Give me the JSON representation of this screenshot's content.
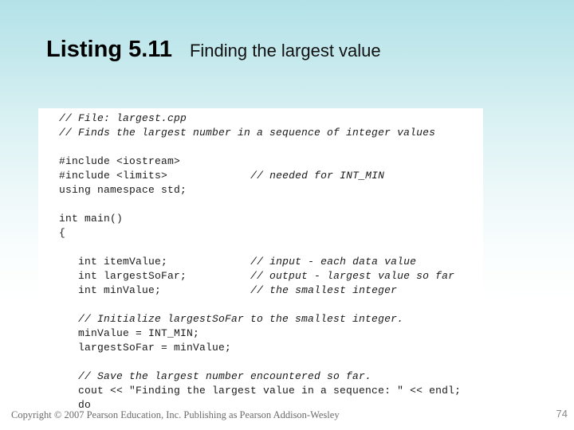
{
  "slide": {
    "background_top_color": "#b3e2e8",
    "background_bottom_color": "#ffffff"
  },
  "title": {
    "main": "Listing 5.11",
    "subtitle": "Finding the largest value"
  },
  "code": {
    "language": "cpp",
    "panel_background": "#ffffff",
    "lines": [
      {
        "code": "// File: largest.cpp",
        "comment": "",
        "comment_col": 0,
        "code_italic": true
      },
      {
        "code": "// Finds the largest number in a sequence of integer values",
        "comment": "",
        "comment_col": 0,
        "code_italic": true
      },
      {
        "code": "",
        "comment": "",
        "comment_col": 0,
        "code_italic": false
      },
      {
        "code": "#include <iostream>",
        "comment": "",
        "comment_col": 0,
        "code_italic": false
      },
      {
        "code": "#include <limits>",
        "comment": "// needed for INT_MIN",
        "comment_col": 30,
        "code_italic": false
      },
      {
        "code": "using namespace std;",
        "comment": "",
        "comment_col": 0,
        "code_italic": false
      },
      {
        "code": "",
        "comment": "",
        "comment_col": 0,
        "code_italic": false
      },
      {
        "code": "int main()",
        "comment": "",
        "comment_col": 0,
        "code_italic": false
      },
      {
        "code": "{",
        "comment": "",
        "comment_col": 0,
        "code_italic": false
      },
      {
        "code": "",
        "comment": "",
        "comment_col": 0,
        "code_italic": false
      },
      {
        "code": "   int itemValue;",
        "comment": "// input - each data value",
        "comment_col": 30,
        "code_italic": false
      },
      {
        "code": "   int largestSoFar;",
        "comment": "// output - largest value so far",
        "comment_col": 30,
        "code_italic": false
      },
      {
        "code": "   int minValue;",
        "comment": "// the smallest integer",
        "comment_col": 30,
        "code_italic": false
      },
      {
        "code": "",
        "comment": "",
        "comment_col": 0,
        "code_italic": false
      },
      {
        "code": "   // Initialize largestSoFar to the smallest integer.",
        "comment": "",
        "comment_col": 0,
        "code_italic": true
      },
      {
        "code": "   minValue = INT_MIN;",
        "comment": "",
        "comment_col": 0,
        "code_italic": false
      },
      {
        "code": "   largestSoFar = minValue;",
        "comment": "",
        "comment_col": 0,
        "code_italic": false
      },
      {
        "code": "",
        "comment": "",
        "comment_col": 0,
        "code_italic": false
      },
      {
        "code": "   // Save the largest number encountered so far.",
        "comment": "",
        "comment_col": 0,
        "code_italic": true
      },
      {
        "code": "   cout << \"Finding the largest value in a sequence: \" << endl;",
        "comment": "",
        "comment_col": 0,
        "code_italic": false
      },
      {
        "code": "   do",
        "comment": "",
        "comment_col": 0,
        "code_italic": false
      },
      {
        "code": "   {",
        "comment": "",
        "comment_col": 0,
        "code_italic": false
      }
    ]
  },
  "footer": {
    "copyright": "Copyright © 2007 Pearson Education, Inc. Publishing as Pearson Addison-Wesley",
    "page_number": "74"
  }
}
